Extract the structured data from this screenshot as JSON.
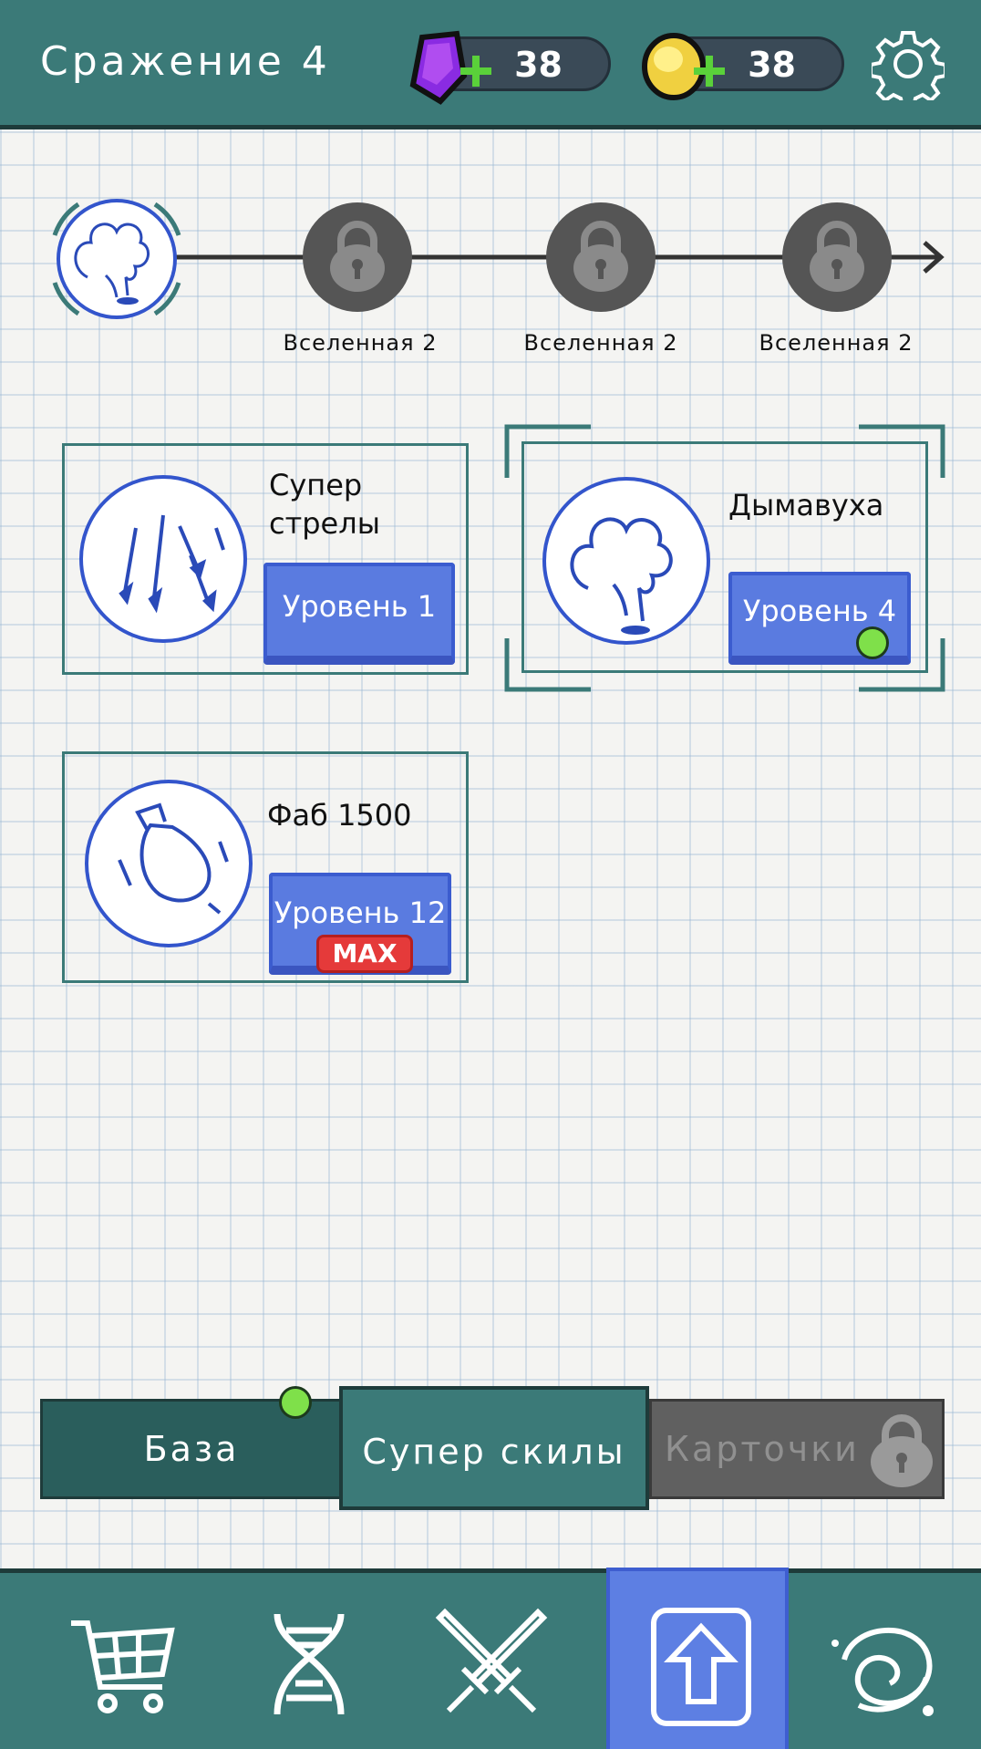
{
  "header": {
    "title": "Сражение 4",
    "gems": "38",
    "coins": "38"
  },
  "track": {
    "nodes": [
      {
        "label": "",
        "state": "current",
        "icon": "smoke-icon"
      },
      {
        "label": "Вселенная 2",
        "state": "locked",
        "icon": "lock-icon"
      },
      {
        "label": "Вселенная 2",
        "state": "locked",
        "icon": "lock-icon"
      },
      {
        "label": "Вселенная 2",
        "state": "locked",
        "icon": "lock-icon"
      }
    ]
  },
  "skills": [
    {
      "name_line1": "Супер",
      "name_line2": "стрелы",
      "level": "Уровень 1",
      "icon": "arrows-icon"
    },
    {
      "name_line1": "Дымавуха",
      "name_line2": "",
      "level": "Уровень 4",
      "icon": "smoke-icon",
      "selected": true
    },
    {
      "name_line1": "Фаб 1500",
      "name_line2": "",
      "level": "Уровень 12",
      "badge": "MAX",
      "icon": "bomb-icon"
    }
  ],
  "subtabs": [
    {
      "label": "База",
      "state": "normal"
    },
    {
      "label": "Супер скилы",
      "state": "active"
    },
    {
      "label": "Карточки",
      "state": "locked"
    }
  ],
  "nav": [
    "shop-cart-icon",
    "dna-icon",
    "swords-icon",
    "upgrade-icon",
    "galaxy-icon"
  ],
  "colors": {
    "teal": "#3b7a78",
    "dark_teal": "#2a5e5c",
    "blue": "#5a7be0",
    "green_dot": "#7fe04a",
    "red_badge": "#e53a3a",
    "locked_gray": "#606060"
  }
}
